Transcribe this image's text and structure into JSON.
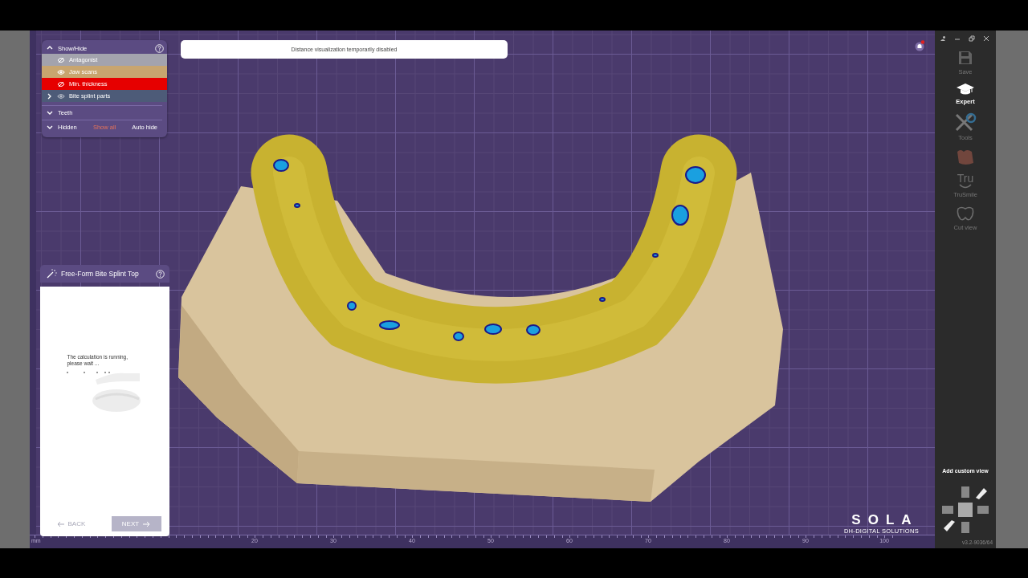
{
  "notification": {
    "text": "Distance visualization temporarily disabled",
    "unread": true
  },
  "show_hide": {
    "title": "Show/Hide",
    "expanded": true,
    "items": [
      {
        "kind": "layer",
        "label": "Antagonist",
        "visible": false,
        "color": "#a3a3ad"
      },
      {
        "kind": "layer",
        "label": "Jaw scans",
        "visible": true,
        "color": "#c8a56f"
      },
      {
        "kind": "layer",
        "label": "Min. thickness",
        "visible": false,
        "color": "#e60000"
      },
      {
        "kind": "group",
        "label": "Bite splint parts",
        "visible": true,
        "expanded": false,
        "color": "#4d5b78"
      }
    ],
    "sections": [
      {
        "label": "Teeth",
        "expanded": false
      },
      {
        "label": "Hidden",
        "expanded": false
      }
    ],
    "show_all": "Show all",
    "auto_hide": "Auto hide"
  },
  "wizard": {
    "title": "Free-Form Bite Splint Top",
    "message": "The calculation is running, please wait ...",
    "back": {
      "label": "BACK",
      "disabled": true
    },
    "next": {
      "label": "NEXT",
      "disabled": true
    }
  },
  "ruler": {
    "unit": "mm",
    "ticks": [
      "20",
      "30",
      "40",
      "50",
      "60",
      "70",
      "80",
      "90",
      "100"
    ]
  },
  "logo": {
    "name": "SOLA",
    "tagline": "DH-DIGITAL SOLUTIONS"
  },
  "toolbar": {
    "items": [
      {
        "kind": "save",
        "label": "Save",
        "active": false
      },
      {
        "kind": "expert",
        "label": "Expert",
        "active": true
      },
      {
        "kind": "tools",
        "label": "Tools",
        "active": false
      },
      {
        "kind": "visual",
        "active": false
      },
      {
        "kind": "trusmile",
        "label": "TruSmile",
        "icon_text": "Tru",
        "active": false
      },
      {
        "kind": "cut",
        "label": "Cut view",
        "active": false
      }
    ],
    "custom_view": "Add custom view",
    "version": "v3.2-9036/64"
  }
}
